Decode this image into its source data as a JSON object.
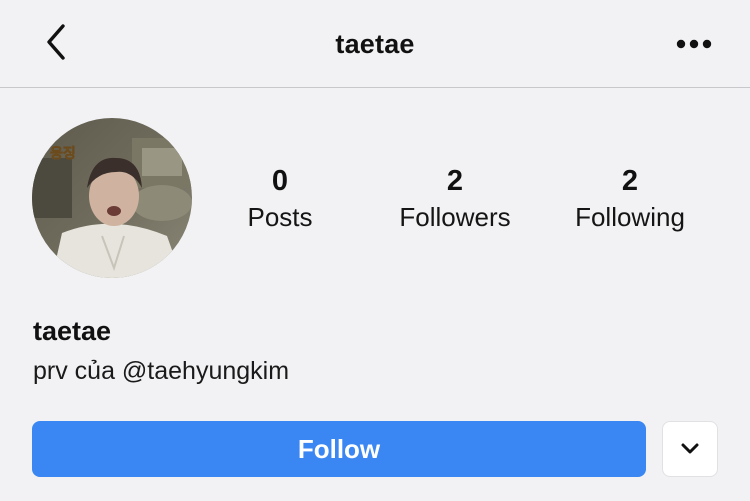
{
  "header": {
    "title": "taetae",
    "back_icon": "chevron-left-icon",
    "more_icon": "more-horizontal-icon"
  },
  "profile": {
    "avatar_sticker_text": "웅징",
    "stats": [
      {
        "value": "0",
        "label": "Posts"
      },
      {
        "value": "2",
        "label": "Followers"
      },
      {
        "value": "2",
        "label": "Following"
      }
    ],
    "name": "taetae",
    "bio": "prv của @taehyungkim"
  },
  "actions": {
    "follow_label": "Follow",
    "dropdown_icon": "chevron-down-icon"
  },
  "colors": {
    "accent": "#3a86f2",
    "background": "#f2f2f4"
  }
}
